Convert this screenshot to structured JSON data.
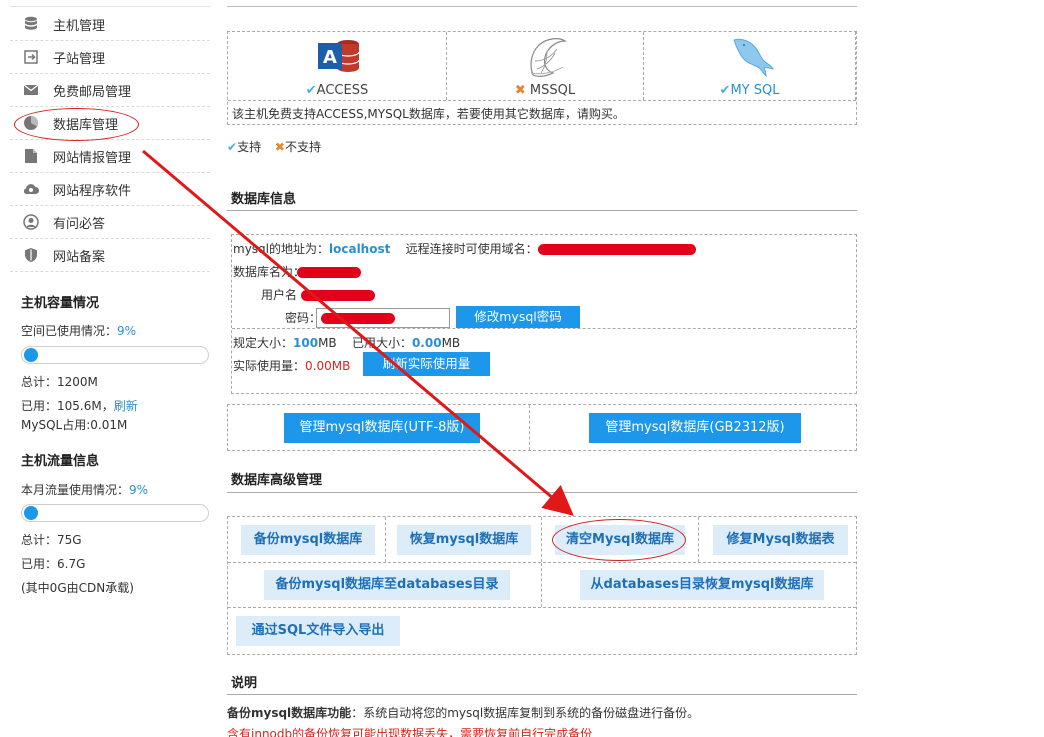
{
  "sidebar": {
    "nav": [
      {
        "label": "主机管理",
        "icon": "database-icon"
      },
      {
        "label": "子站管理",
        "icon": "export-icon"
      },
      {
        "label": "免费邮局管理",
        "icon": "mail-icon"
      },
      {
        "label": "数据库管理",
        "icon": "pie-chart-icon"
      },
      {
        "label": "网站情报管理",
        "icon": "document-icon"
      },
      {
        "label": "网站程序软件",
        "icon": "cloud-icon"
      },
      {
        "label": "有问必答",
        "icon": "user-icon"
      },
      {
        "label": "网站备案",
        "icon": "shield-icon"
      }
    ],
    "capacity": {
      "title": "主机容量情况",
      "used_label": "空间已使用情况：",
      "used_pct": "9%",
      "used_fraction": 0.09,
      "total": "总计：1200M",
      "used_prefix": "已用：105.6M，",
      "refresh": "刷新",
      "mysql": "MySQL占用:0.01M"
    },
    "traffic": {
      "title": "主机流量信息",
      "used_label": "本月流量使用情况：",
      "used_pct": "9%",
      "used_fraction": 0.09,
      "total": "总计：75G",
      "used": "已用：6.7G",
      "cdn": "(其中0G由CDN承载)"
    }
  },
  "dbtypes": {
    "items": [
      {
        "name": "ACCESS",
        "supported": true,
        "mark": "✔",
        "icon": "access-logo-icon"
      },
      {
        "name": "MSSQL",
        "supported": false,
        "mark": "✖",
        "icon": "mssql-logo-icon"
      },
      {
        "name": "MY SQL",
        "supported": true,
        "mark": "✔",
        "icon": "mysql-dolphin-icon"
      }
    ],
    "note": "该主机免费支持ACCESS,MYSQL数据库，若要使用其它数据库，请购买。",
    "legend_support": "支持",
    "legend_unsupport": "不支持"
  },
  "info": {
    "title": "数据库信息",
    "address_label": "mysql的地址为：",
    "address_value": "localhost",
    "remote_label": "远程连接时可使用域名：",
    "dbname_label": "数据库名为：",
    "user_label": "用户名",
    "pwd_label": "密码：",
    "change_pwd_btn": "修改mysql密码",
    "quota_label": "规定大小：",
    "quota_value": "100",
    "quota_unit": "MB",
    "used_label": "已用大小：",
    "used_value": "0.00",
    "used_unit": "MB",
    "actual_label": "实际使用量：",
    "actual_value": "0.00MB",
    "refresh_btn": "刷新实际使用量"
  },
  "manage": {
    "utf8_btn": "管理mysql数据库(UTF-8版)",
    "gb_btn": "管理mysql数据库(GB2312版)"
  },
  "advanced": {
    "title": "数据库高级管理",
    "backup": "备份mysql数据库",
    "restore": "恢复mysql数据库",
    "clear": "清空Mysql数据库",
    "repair": "修复Mysql数据表",
    "backup_dir": "备份mysql数据库至databases目录",
    "restore_dir": "从databases目录恢复mysql数据库",
    "sql_io": "通过SQL文件导入导出"
  },
  "description": {
    "title": "说明",
    "backup_title": "备份mysql数据库功能",
    "backup_text": "：系统自动将您的mysql数据库复制到系统的备份磁盘进行备份。",
    "warning": "含有innodb的备份恢复可能出现数据丢失，需要恢复前自行完成备份"
  },
  "colors": {
    "accent": "#1c97ea",
    "light_button": "#dcecf9",
    "annotation_red": "#d32020"
  }
}
